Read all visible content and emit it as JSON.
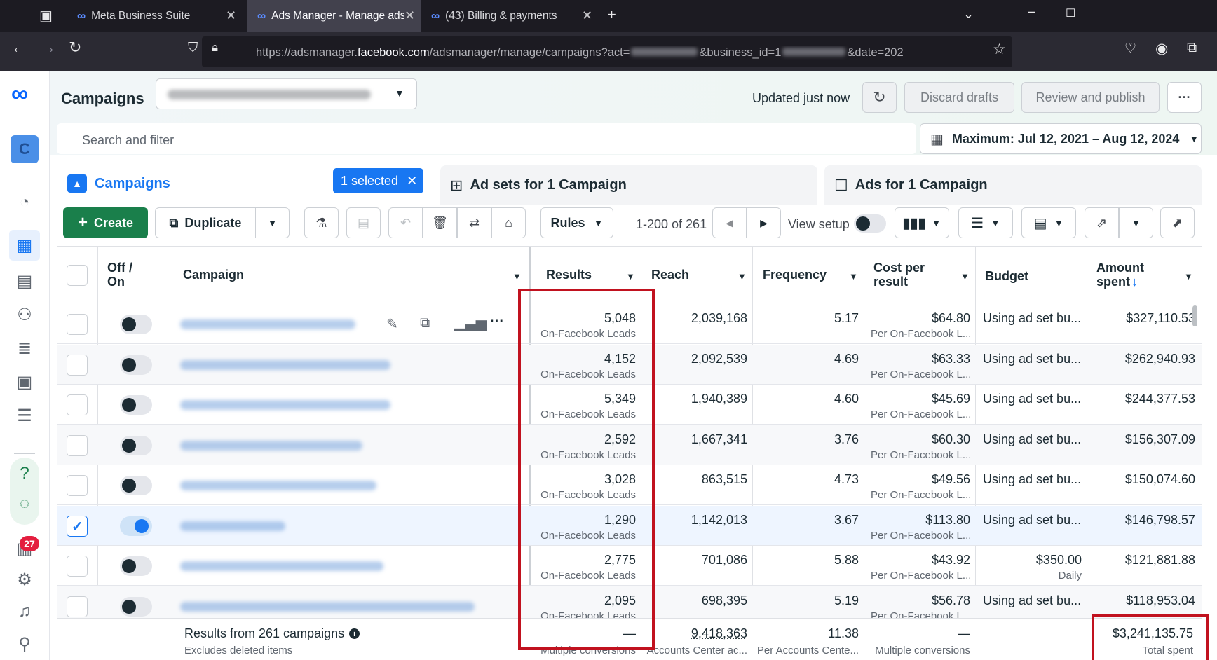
{
  "browser": {
    "tabs": [
      {
        "label": "Meta Business Suite"
      },
      {
        "label": "Ads Manager - Manage ads - C"
      },
      {
        "label": "(43) Billing & payments"
      }
    ],
    "url_prefix": "https://adsmanager.",
    "url_domain": "facebook.com",
    "url_rest": "/adsmanager/manage/campaigns?act=",
    "url_mid": "&business_id=1",
    "url_end": "&date=202"
  },
  "leftnav": {
    "avatar": "C",
    "notification_count": "27"
  },
  "header": {
    "title": "Campaigns",
    "account_select": "3047193...(3047193...",
    "updated": "Updated just now",
    "discard": "Discard drafts",
    "review": "Review and publish",
    "more": "···"
  },
  "search": {
    "placeholder": "Search and filter"
  },
  "date_range": "Maximum: Jul 12, 2021 – Aug 12, 2024",
  "level_tabs": {
    "campaigns": "Campaigns",
    "selected": "1 selected",
    "adsets": "Ad sets for 1 Campaign",
    "ads": "Ads for 1 Campaign"
  },
  "toolbar": {
    "create": "Create",
    "duplicate": "Duplicate",
    "rules": "Rules",
    "pagination": "1-200 of 261",
    "view_setup": "View setup"
  },
  "columns": {
    "offon": "Off /\nOn",
    "campaign": "Campaign",
    "results": "Results",
    "reach": "Reach",
    "frequency": "Frequency",
    "cost": "Cost per\nresult",
    "budget": "Budget",
    "spent": "Amount\nspent"
  },
  "rows": [
    {
      "results": "5,048",
      "results_sub": "On-Facebook Leads",
      "reach": "2,039,168",
      "freq": "5.17",
      "cost": "$64.80",
      "cost_sub": "Per On-Facebook L...",
      "budget": "Using ad set bu...",
      "budget_sub": "",
      "spent": "$327,110.53"
    },
    {
      "results": "4,152",
      "results_sub": "On-Facebook Leads",
      "reach": "2,092,539",
      "freq": "4.69",
      "cost": "$63.33",
      "cost_sub": "Per On-Facebook L...",
      "budget": "Using ad set bu...",
      "budget_sub": "",
      "spent": "$262,940.93"
    },
    {
      "results": "5,349",
      "results_sub": "On-Facebook Leads",
      "reach": "1,940,389",
      "freq": "4.60",
      "cost": "$45.69",
      "cost_sub": "Per On-Facebook L...",
      "budget": "Using ad set bu...",
      "budget_sub": "",
      "spent": "$244,377.53"
    },
    {
      "results": "2,592",
      "results_sub": "On-Facebook Leads",
      "reach": "1,667,341",
      "freq": "3.76",
      "cost": "$60.30",
      "cost_sub": "Per On-Facebook L...",
      "budget": "Using ad set bu...",
      "budget_sub": "",
      "spent": "$156,307.09"
    },
    {
      "results": "3,028",
      "results_sub": "On-Facebook Leads",
      "reach": "863,515",
      "freq": "4.73",
      "cost": "$49.56",
      "cost_sub": "Per On-Facebook L...",
      "budget": "Using ad set bu...",
      "budget_sub": "",
      "spent": "$150,074.60"
    },
    {
      "results": "1,290",
      "results_sub": "On-Facebook Leads",
      "reach": "1,142,013",
      "freq": "3.67",
      "cost": "$113.80",
      "cost_sub": "Per On-Facebook L...",
      "budget": "Using ad set bu...",
      "budget_sub": "",
      "spent": "$146,798.57"
    },
    {
      "results": "2,775",
      "results_sub": "On-Facebook Leads",
      "reach": "701,086",
      "freq": "5.88",
      "cost": "$43.92",
      "cost_sub": "Per On-Facebook L...",
      "budget": "$350.00",
      "budget_sub": "Daily",
      "spent": "$121,881.88"
    },
    {
      "results": "2,095",
      "results_sub": "On-Facebook Leads",
      "reach": "698,395",
      "freq": "5.19",
      "cost": "$56.78",
      "cost_sub": "Per On-Facebook L...",
      "budget": "Using ad set bu...",
      "budget_sub": "",
      "spent": "$118,953.04"
    }
  ],
  "footer": {
    "title": "Results from 261 campaigns",
    "sub": "Excludes deleted items",
    "results": "—",
    "results_sub": "Multiple conversions",
    "reach": "9,418,363",
    "reach_sub": "Accounts Center ac...",
    "freq": "11.38",
    "freq_sub": "Per Accounts Cente...",
    "cost": "—",
    "cost_sub": "Multiple conversions",
    "spent": "$3,241,135.75",
    "spent_sub": "Total spent"
  },
  "colors": {
    "accent": "#1877f2",
    "create": "#1a7f4b",
    "highlight": "#c1121f"
  }
}
